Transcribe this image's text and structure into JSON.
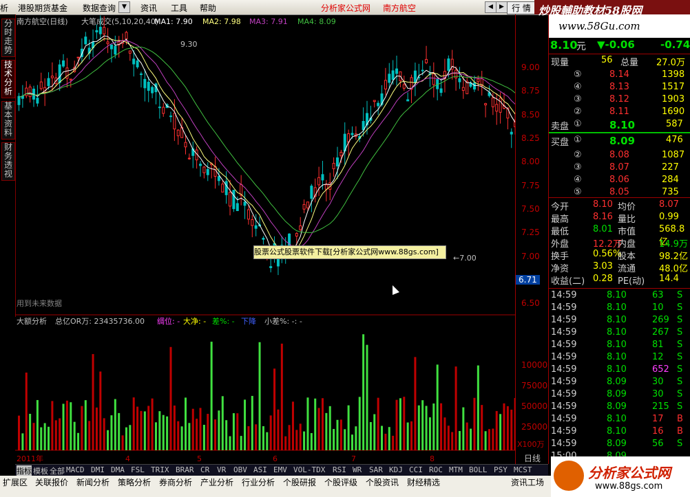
{
  "menu": {
    "items": [
      "析",
      "港股期货基金",
      "数据查询",
      "资讯",
      "工具",
      "帮助"
    ],
    "center_title": "分析家公式网",
    "stock_title": "南方航空",
    "trade_button": "行 情",
    "brand_top": "炒股輔助教材58股网",
    "brand_url": "www.58Gu.com"
  },
  "left_tabs": [
    "分时走势",
    "技术分析",
    "基本资料",
    "财务透视"
  ],
  "main_chart": {
    "header": {
      "stock": "南方航空(日线)",
      "indicator": "大笔成交(5,10,20,40)",
      "ma1": "MA1: 7.90",
      "ma2": "MA2: 7.98",
      "ma3": "MA3: 7.91",
      "ma4": "MA4: 8.09"
    },
    "annotations": {
      "high": "9.30",
      "low": "←7.00",
      "future": "用到未来数据"
    },
    "price_labels": [
      "9.00",
      "8.75",
      "8.50",
      "8.25",
      "8.00",
      "7.75",
      "7.50",
      "7.25",
      "7.00",
      "6.75",
      "6.50"
    ],
    "current_price": "6.71"
  },
  "sub_chart": {
    "header": {
      "name": "大额分析",
      "total": "总亿OR万: 23435736.00",
      "pos": "绸位: -",
      "big_net": "大净: -",
      "diff": "差%: -",
      "down": "下降",
      "small_diff": "小差%: -: -"
    },
    "axis_labels": [
      "100000",
      "75000",
      "50000",
      "25000"
    ],
    "unit": "X100万"
  },
  "timeline": {
    "labels": [
      "2011年",
      "4",
      "5",
      "6",
      "7",
      "8"
    ],
    "period": "日线"
  },
  "watermark": "股票公式股票软件下载[分析家公式网www.88gs.com]",
  "quote": {
    "price": "8.10",
    "price_unit": "元",
    "change": "▼-0.06",
    "change_pct": "-0.74",
    "now_vol_label": "现量",
    "now_vol": "56",
    "total_vol_label": "总量",
    "total_vol": "27.0万",
    "asks": [
      {
        "lvl": "⑤",
        "price": "8.14",
        "vol": "1398"
      },
      {
        "lvl": "④",
        "price": "8.13",
        "vol": "1517"
      },
      {
        "lvl": "③",
        "price": "8.12",
        "vol": "1903"
      },
      {
        "lvl": "②",
        "price": "8.11",
        "vol": "1690"
      }
    ],
    "ask1": {
      "label": "卖盘",
      "lvl": "①",
      "price": "8.10",
      "vol": "587"
    },
    "bid1": {
      "label": "买盘",
      "lvl": "①",
      "price": "8.09",
      "vol": "476"
    },
    "bids": [
      {
        "lvl": "②",
        "price": "8.08",
        "vol": "1087"
      },
      {
        "lvl": "③",
        "price": "8.07",
        "vol": "227"
      },
      {
        "lvl": "④",
        "price": "8.06",
        "vol": "284"
      },
      {
        "lvl": "⑤",
        "price": "8.05",
        "vol": "735"
      }
    ],
    "stats": [
      {
        "l1": "今开",
        "v1": "8.10",
        "l2": "均价",
        "v2": "8.07",
        "c1": "r",
        "c2": "r"
      },
      {
        "l1": "最高",
        "v1": "8.16",
        "l2": "量比",
        "v2": "0.99",
        "c1": "r",
        "c2": "y"
      },
      {
        "l1": "最低",
        "v1": "8.01",
        "l2": "市值",
        "v2": "568.8亿",
        "c1": "g",
        "c2": "y"
      },
      {
        "l1": "外盘",
        "v1": "12.2万",
        "l2": "内盘",
        "v2": "14.9万",
        "c1": "r",
        "c2": "g"
      },
      {
        "l1": "换手",
        "v1": "0.56%",
        "l2": "股本",
        "v2": "98.2亿",
        "c1": "y",
        "c2": "y"
      },
      {
        "l1": "净资",
        "v1": "3.03",
        "l2": "流通",
        "v2": "48.0亿",
        "c1": "y",
        "c2": "y"
      },
      {
        "l1": "收益(二)",
        "v1": "0.28",
        "l2": "PE(动)",
        "v2": "14.4",
        "c1": "y",
        "c2": "y"
      }
    ],
    "ticks": [
      {
        "t": "14:59",
        "p": "8.10",
        "v": "63",
        "s": "S",
        "c": "g",
        "vc": "g"
      },
      {
        "t": "14:59",
        "p": "8.10",
        "v": "10",
        "s": "S",
        "c": "g",
        "vc": "g"
      },
      {
        "t": "14:59",
        "p": "8.10",
        "v": "269",
        "s": "S",
        "c": "g",
        "vc": "g"
      },
      {
        "t": "14:59",
        "p": "8.10",
        "v": "267",
        "s": "S",
        "c": "g",
        "vc": "g"
      },
      {
        "t": "14:59",
        "p": "8.10",
        "v": "81",
        "s": "S",
        "c": "g",
        "vc": "g"
      },
      {
        "t": "14:59",
        "p": "8.10",
        "v": "12",
        "s": "S",
        "c": "g",
        "vc": "g"
      },
      {
        "t": "14:59",
        "p": "8.10",
        "v": "652",
        "s": "S",
        "c": "g",
        "vc": "m"
      },
      {
        "t": "14:59",
        "p": "8.09",
        "v": "30",
        "s": "S",
        "c": "g",
        "vc": "g"
      },
      {
        "t": "14:59",
        "p": "8.09",
        "v": "30",
        "s": "S",
        "c": "g",
        "vc": "g"
      },
      {
        "t": "14:59",
        "p": "8.09",
        "v": "215",
        "s": "S",
        "c": "g",
        "vc": "g"
      },
      {
        "t": "14:59",
        "p": "8.10",
        "v": "17",
        "s": "B",
        "c": "g",
        "vc": "r"
      },
      {
        "t": "14:59",
        "p": "8.10",
        "v": "16",
        "s": "B",
        "c": "g",
        "vc": "r"
      },
      {
        "t": "14:59",
        "p": "8.09",
        "v": "56",
        "s": "S",
        "c": "g",
        "vc": "g"
      },
      {
        "t": "15:00",
        "p": "8.09",
        "v": "",
        "s": "",
        "c": "g",
        "vc": "g"
      }
    ]
  },
  "indicator_tabs": [
    "指标",
    "模板",
    "全部",
    "MACD",
    "DMI",
    "DMA",
    "FSL",
    "TRIX",
    "BRAR",
    "CR",
    "VR",
    "OBV",
    "ASI",
    "EMV",
    "VOL-TDX",
    "RSI",
    "WR",
    "SAR",
    "KDJ",
    "CCI",
    "ROC",
    "MTM",
    "BOLL",
    "PSY",
    "MCST"
  ],
  "footer_tabs": [
    "扩展区",
    "关联报价",
    "新闻分析",
    "策略分析",
    "券商分析",
    "产业分析",
    "行业分析",
    "个股研报",
    "个股评级",
    "个股资讯",
    "财经精选",
    "资讯工场"
  ],
  "footer_logo": {
    "title": "分析家公式网",
    "url": "www.88gs.com"
  },
  "colors": {
    "up": "#ff3030",
    "down": "#00e000",
    "ma1": "#ffffff",
    "ma2": "#ffff80",
    "ma3": "#c040c0",
    "ma4": "#40c040",
    "panel_border": "#a00000"
  }
}
